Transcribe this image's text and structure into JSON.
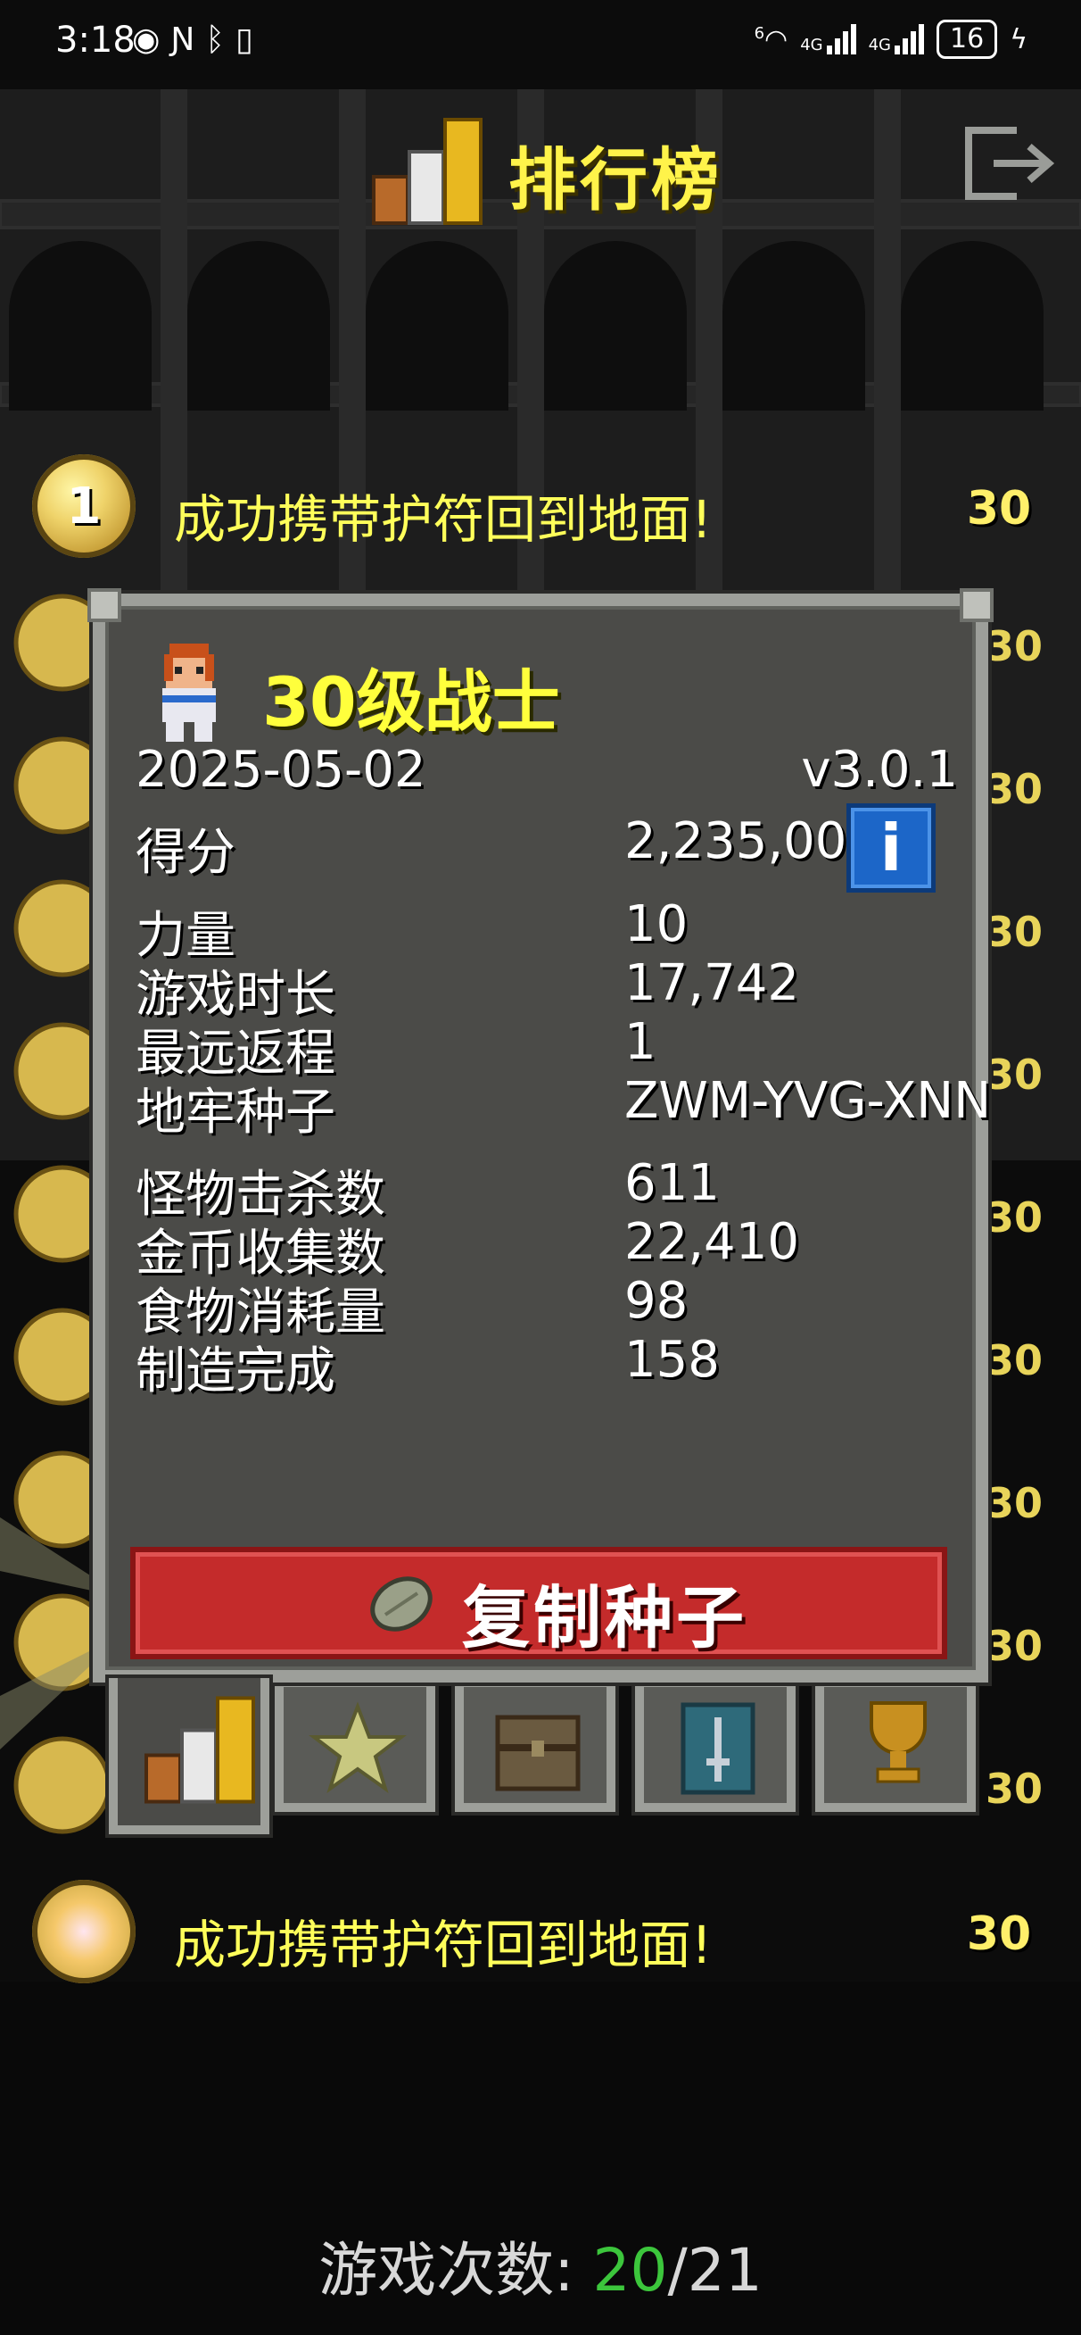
{
  "status_bar": {
    "time": "3:18",
    "left_icons": [
      "eye-icon",
      "nfc-icon",
      "bluetooth-icon",
      "vibrate-icon"
    ],
    "wifi_label": "6",
    "signal1_label": "4G",
    "signal2_label": "4G",
    "battery": "16"
  },
  "header": {
    "title": "排行榜",
    "exit_icon": "exit-icon",
    "icon": "podium-icon"
  },
  "rows": [
    {
      "rank": "1",
      "text": "成功携带护符回到地面!",
      "level": "30"
    },
    {
      "rank": "",
      "text": "成功携带护符回到地面!",
      "level": "30"
    }
  ],
  "dialog": {
    "title": "30级战士",
    "date": "2025-05-02",
    "version": "v3.0.1",
    "score_label": "得分",
    "score_value": "2,235,000",
    "stats": [
      {
        "label": "力量",
        "value": "10"
      },
      {
        "label": "游戏时长",
        "value": "17,742"
      },
      {
        "label": "最远返程",
        "value": "1"
      },
      {
        "label": "地牢种子",
        "value": "ZWM-YVG-XNN"
      }
    ],
    "stats2": [
      {
        "label": "怪物击杀数",
        "value": "611"
      },
      {
        "label": "金币收集数",
        "value": "22,410"
      },
      {
        "label": "食物消耗量",
        "value": "98"
      },
      {
        "label": "制造完成",
        "value": "158"
      }
    ],
    "copy_button": "复制种子",
    "info_button": "i",
    "tabs": [
      "stats-tab-icon",
      "badges-star-icon",
      "chest-icon",
      "sword-scroll-icon",
      "trophy-icon"
    ]
  },
  "footer": {
    "label": "游戏次数:",
    "played": "20",
    "separator": "/",
    "total": "21"
  },
  "colors": {
    "title_yellow": "#fff34a",
    "button_red": "#c42b2b",
    "info_blue": "#1c66c8",
    "played_green": "#3cc63c"
  }
}
